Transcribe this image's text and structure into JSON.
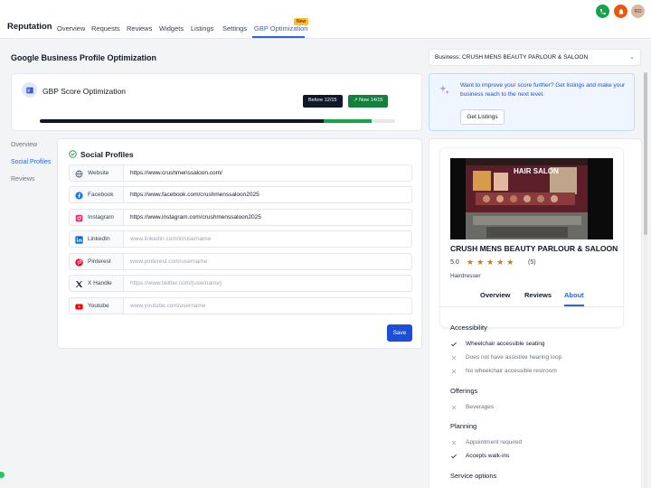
{
  "app": {
    "brand": "Reputation",
    "nav": [
      {
        "label": "Overview"
      },
      {
        "label": "Requests"
      },
      {
        "label": "Reviews"
      },
      {
        "label": "Widgets"
      },
      {
        "label": "Listings"
      },
      {
        "label": "Settings"
      },
      {
        "label": "GBP Optimization",
        "badge": "New",
        "active": true
      }
    ],
    "avatar_initials": "RD",
    "icons": {
      "phone": "phone-icon",
      "notifications": "bell-icon"
    },
    "colors": {
      "accent": "#2563eb",
      "phone": "#16a34a",
      "bell": "#ea580c"
    }
  },
  "page": {
    "title": "Google Business Profile Optimization",
    "business_select": "Business: CRUSH MENS BEAUTY PARLOUR & SALOON"
  },
  "score": {
    "title": "GBP Score Optimization",
    "before_label": "Before 12/15",
    "now_label": "Now 14/15",
    "before_value": 12,
    "now_value": 14,
    "max": 15
  },
  "sidebar": {
    "items": [
      {
        "label": "Overview"
      },
      {
        "label": "Social Profiles",
        "active": true
      },
      {
        "label": "Reviews"
      }
    ]
  },
  "social": {
    "title": "Social Profiles",
    "save_label": "Save",
    "rows": [
      {
        "label": "Website",
        "value": "https://www.crushmenssaloon.com/",
        "placeholder": ""
      },
      {
        "label": "Facebook",
        "value": "https://www.facebook.com/crushmenssaloon2025",
        "placeholder": ""
      },
      {
        "label": "Instagram",
        "value": "https://www.instagram.com/crushmenssaloon2025",
        "placeholder": ""
      },
      {
        "label": "LinkedIn",
        "value": "",
        "placeholder": "www.linkedin.com/in/username"
      },
      {
        "label": "Pinterest",
        "value": "",
        "placeholder": "www.pinterest.com/username"
      },
      {
        "label": "X Handle",
        "value": "",
        "placeholder": "https://www.twitter.com/{username}"
      },
      {
        "label": "Youtube",
        "value": "",
        "placeholder": "www.youtube.com/username"
      }
    ]
  },
  "promo": {
    "text": "Want to improve your score further? Get listings and make your business reach to the next level.",
    "button": "Get Listings"
  },
  "preview": {
    "photo_sign": "HAIR SALON",
    "name": "CRUSH MENS BEAUTY PARLOUR & SALOON",
    "rating": "5.0",
    "stars": 5,
    "review_count": "(5)",
    "category": "Hairdresser",
    "tabs": [
      {
        "label": "Overview"
      },
      {
        "label": "Reviews"
      },
      {
        "label": "About",
        "active": true
      }
    ],
    "sections": [
      {
        "title": "Accessibility",
        "items": [
          {
            "text": "Wheelchair accessible seating",
            "available": true
          },
          {
            "text": "Does not have assistive hearing loop",
            "available": false
          },
          {
            "text": "No wheelchair accessible restroom",
            "available": false
          }
        ]
      },
      {
        "title": "Offerings",
        "items": [
          {
            "text": "Beverages",
            "available": false
          }
        ]
      },
      {
        "title": "Planning",
        "items": [
          {
            "text": "Appointment required",
            "available": false
          },
          {
            "text": "Accepts walk-ins",
            "available": true
          }
        ]
      },
      {
        "title": "Service options",
        "items": []
      }
    ]
  }
}
